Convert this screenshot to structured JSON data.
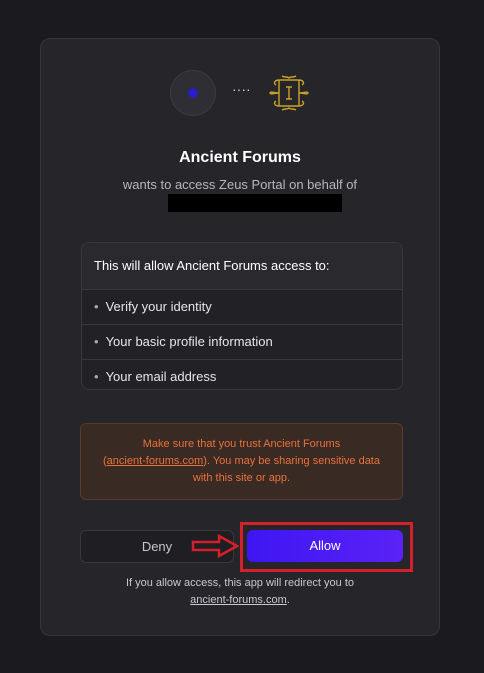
{
  "app": {
    "name": "Ancient Forums",
    "subtitle": "wants to access Zeus Portal on behalf of",
    "connector": "····"
  },
  "permissions": {
    "header": "This will allow Ancient Forums access to:",
    "items": [
      "Verify your identity",
      "Your basic profile information",
      "Your email address"
    ]
  },
  "warning": {
    "line1": "Make sure that you trust Ancient Forums",
    "open_paren": "(",
    "link": "ancient-forums.com",
    "rest": "). You may be sharing sensitive data",
    "line3": "with this site or app."
  },
  "actions": {
    "deny_label": "Deny",
    "allow_label": "Allow"
  },
  "redirect": {
    "text": "If you allow access, this app will redirect you to",
    "link": "ancient-forums.com",
    "period": "."
  },
  "colors": {
    "allow_button": "#4a1cf5",
    "warning_text": "#e8713a",
    "highlight_frame": "#d4202a"
  }
}
